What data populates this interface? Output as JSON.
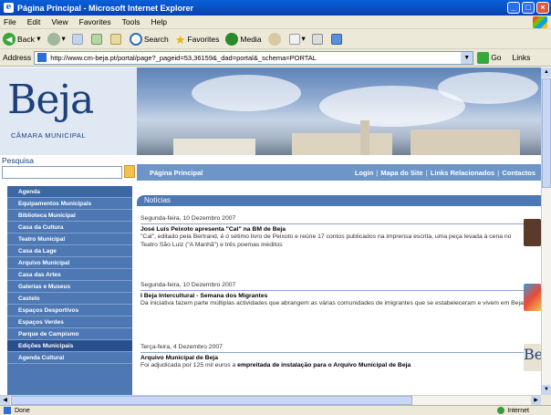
{
  "window": {
    "title": "Página Principal - Microsoft Internet Explorer",
    "controls": {
      "minimize": "_",
      "maximize": "□",
      "close": "×"
    }
  },
  "menu": [
    "File",
    "Edit",
    "View",
    "Favorites",
    "Tools",
    "Help"
  ],
  "toolbar": {
    "back": "Back",
    "search": "Search",
    "favorites": "Favorites",
    "media": "Media"
  },
  "address": {
    "label": "Address",
    "url": "http://www.cm-beja.pt/portal/page?_pageid=53,36159&_dad=portal&_schema=PORTAL",
    "go": "Go",
    "links": "Links"
  },
  "site": {
    "logo": "Beja",
    "logo_sub": "CÂMARA MUNICIPAL",
    "search_label": "Pesquisa",
    "topnav": {
      "home": "Página Principal",
      "links": [
        "Login",
        "Mapa do Site",
        "Links Relacionados",
        "Contactos"
      ]
    },
    "sidebar": [
      "Agenda",
      "Equipamentos Municipais",
      "Biblioteca Municipal",
      "Casa da Cultura",
      "Teatro Municipal",
      "Casa da Lage",
      "Arquivo Municipal",
      "Casa das Artes",
      "Galerias e Museus",
      "Castelo",
      "Espaços Desportivos",
      "Espaços Verdes",
      "Parque de Campismo",
      "Edições Municipais",
      "Agenda Cultural"
    ],
    "news_title": "Notícias",
    "news": [
      {
        "date": "Segunda-feira, 10 Dezembro 2007",
        "headline": "José Luís Peixoto apresenta \"Cal\" na BM de Beja",
        "body": "\"Cal\", editado pela Bertrand, é o sétimo livro de Peixoto e reúne 17 contos publicados na imprensa escrita, uma peça levada à cena no Teatro São Luiz (\"A Manhã\") e três poemas inéditos",
        "thumb_color": "#5a3a2a"
      },
      {
        "date": "Segunda-feira, 10 Dezembro 2007",
        "headline": "I Beja Intercultural - Semana dos Migrantes",
        "body": "Da iniciativa fazem parte múltiplas actividades que abrangem as várias comunidades de imigrantes que se estabeleceram e vivem em Beja",
        "thumb_color": "#3a9ad8"
      },
      {
        "date": "Terça-feira, 4 Dezembro 2007",
        "headline": "Arquivo Municipal de Beja",
        "body_prefix": "Foi adjudicada por 125 mil euros a ",
        "body_bold": "empreitada de instalação para o Arquivo Municipal de Beja",
        "thumb_color": "#e8e2d0"
      }
    ]
  },
  "status": {
    "text": "Done",
    "zone": "Internet"
  }
}
